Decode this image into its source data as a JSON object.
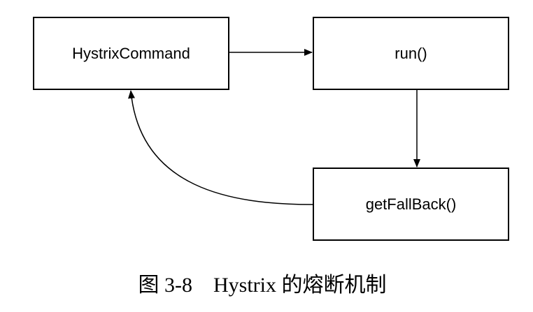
{
  "diagram": {
    "nodes": {
      "command": "HystrixCommand",
      "run": "run()",
      "fallback": "getFallBack()"
    },
    "caption": "图 3-8　Hystrix 的熔断机制"
  }
}
